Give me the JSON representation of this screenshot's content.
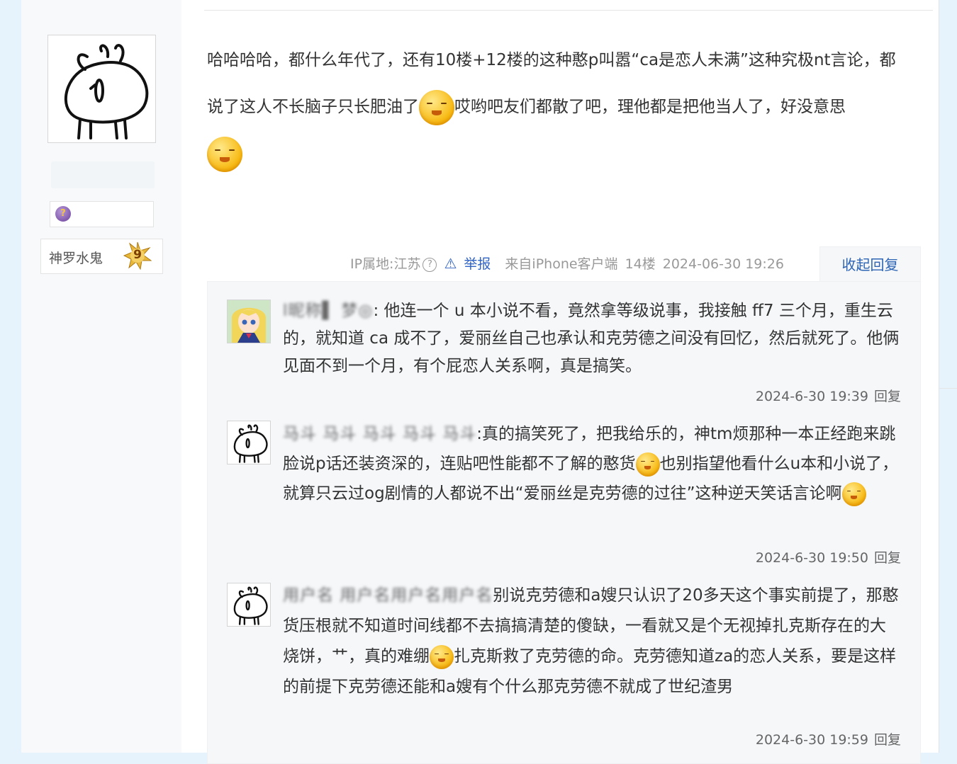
{
  "author": {
    "name": "神罗水鬼",
    "level": "9",
    "badge_icon": "question-medal-icon",
    "avatar_icon": "rabbit-sketch-avatar"
  },
  "post": {
    "text_1": "哈哈哈哈，都什么年代了，还有10楼+12楼的这种憨p叫嚣“ca是恋人未满”这种究极nt言论，都说了这人不长脑子只长肥油了",
    "text_2": "哎哟吧友们都散了吧，理他都是把他当人了，好没意思",
    "emoji_1": "shy-face-emoji",
    "emoji_2": "shy-face-emoji"
  },
  "tail": {
    "ip": "IP属地:江苏",
    "report": "举报",
    "client": "来自iPhone客户端",
    "floor": "14楼",
    "time": "2024-06-30 19:26",
    "fold": "收起回复"
  },
  "replies": [
    {
      "user": "l昵称▌ 梦◎",
      "text": ": 他连一个 u 本小说不看，竟然拿等级说事，我接触 ff7 三个月，重生云的，就知道 ca 成不了，爱丽丝自己也承认和克劳德之间没有回忆，然后就死了。他俩见面不到一个月，有个屁恋人关系啊，真是搞笑。",
      "time": "2024-6-30 19:39",
      "reply": "回复"
    },
    {
      "user": "马斗 马斗 马斗 马斗 马斗",
      "text_a": ":真的搞笑死了，把我给乐的，神tm烦那种一本正经跑来跳脸说p话还装资深的，连贴吧性能都不了解的憨货",
      "text_b": "也别指望他看什么u本和小说了，就算只云过og剧情的人都说不出“爱丽丝是克劳德的过往”这种逆天笑话言论啊",
      "time": "2024-6-30 19:50",
      "reply": "回复"
    },
    {
      "user": "用户名 用户名用户名用户名",
      "text_a": "别说克劳德和a嫂只认识了20多天这个事实前提了，那憨货压根就不知道时间线都不去搞搞清楚的傻缺，一看就又是个无视掉扎克斯存在的大烧饼，艹，真的难绷",
      "text_b": "扎克斯救了克劳德的命。克劳德知道za的恋人关系，要是这样的前提下克劳德还能和a嫂有个什么那克劳德不就成了世纪渣男",
      "time": "2024-6-30 19:59",
      "reply": "回复"
    }
  ],
  "colors": {
    "link": "#3163c4",
    "fold": "#2d64b3",
    "page_bg": "#e6f2fc"
  }
}
